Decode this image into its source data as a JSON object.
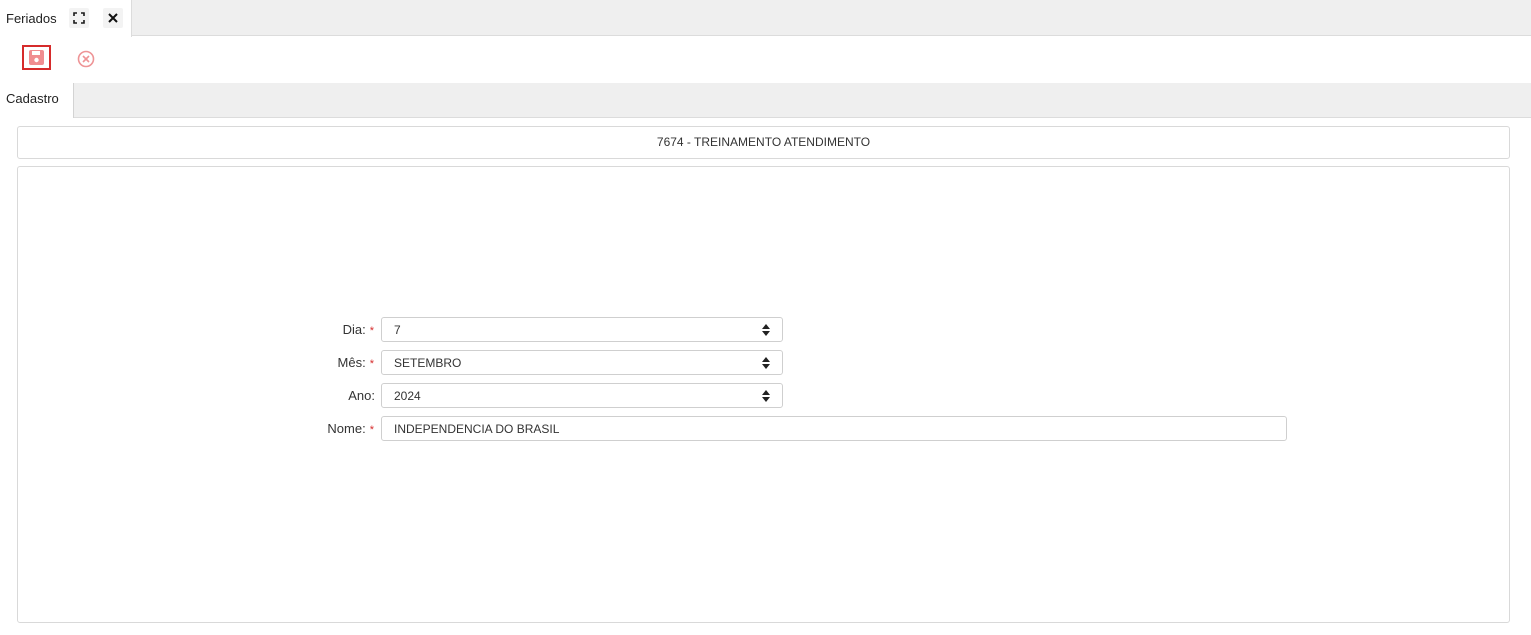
{
  "window_tab": {
    "title": "Feriados",
    "expand_icon": "expand-icon",
    "close_icon": "close-icon"
  },
  "toolbar": {
    "save_icon": "floppy-disk-icon",
    "cancel_icon": "circle-x-icon",
    "save_border_color": "#d62b2b",
    "cancel_color": "#e8898b"
  },
  "section_tabs": [
    {
      "label": "Cadastro",
      "active": true
    }
  ],
  "company_header": "7674 - TREINAMENTO ATENDIMENTO",
  "form": {
    "dia": {
      "label": "Dia:",
      "required": "*",
      "value": "7"
    },
    "mes": {
      "label": "Mês:",
      "required": "*",
      "value": "SETEMBRO"
    },
    "ano": {
      "label": "Ano:",
      "value": "2024"
    },
    "nome": {
      "label": "Nome:",
      "required": "*",
      "value": "INDEPENDENCIA DO BRASIL"
    }
  }
}
